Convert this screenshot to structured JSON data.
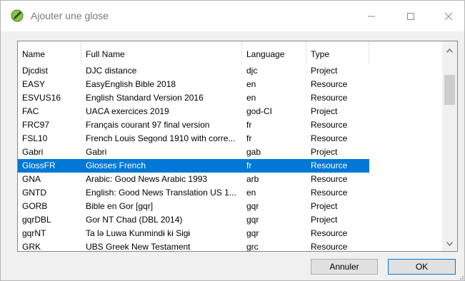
{
  "window": {
    "title": "Ajouter une glose"
  },
  "list": {
    "columns": [
      "Name",
      "Full Name",
      "Language",
      "Type",
      ""
    ],
    "rows": [
      {
        "name": "Djcdist",
        "full_name": "DJC distance",
        "language": "djc",
        "type": "Project",
        "selected": false
      },
      {
        "name": "EASY",
        "full_name": "EasyEnglish Bible 2018",
        "language": "en",
        "type": "Resource",
        "selected": false
      },
      {
        "name": "ESVUS16",
        "full_name": "English Standard Version 2016",
        "language": "en",
        "type": "Resource",
        "selected": false
      },
      {
        "name": "FAC",
        "full_name": "UACA exercices 2019",
        "language": "god-CI",
        "type": "Project",
        "selected": false
      },
      {
        "name": "FRC97",
        "full_name": "Français courant 97 final version",
        "language": "fr",
        "type": "Resource",
        "selected": false
      },
      {
        "name": "FSL10",
        "full_name": "French Louis Segond 1910 with corre...",
        "language": "fr",
        "type": "Resource",
        "selected": false
      },
      {
        "name": "Gabri",
        "full_name": "Gabri",
        "language": "gab",
        "type": "Project",
        "selected": false
      },
      {
        "name": "GlossFR",
        "full_name": "Glosses French",
        "language": "fr",
        "type": "Resource",
        "selected": true
      },
      {
        "name": "GNA",
        "full_name": "Arabic: Good News Arabic 1993",
        "language": "arb",
        "type": "Resource",
        "selected": false
      },
      {
        "name": "GNTD",
        "full_name": "English: Good News Translation US 1...",
        "language": "en",
        "type": "Resource",
        "selected": false
      },
      {
        "name": "GORB",
        "full_name": "Bible en Gor [gqr]",
        "language": "gqr",
        "type": "Project",
        "selected": false
      },
      {
        "name": "gqrDBL",
        "full_name": "Gor NT Chad (DBL 2014)",
        "language": "gqr",
        "type": "Project",
        "selected": false
      },
      {
        "name": "gqrNT",
        "full_name": "Ta lə Luwa Kunmindɨ kɨ Sigɨ",
        "language": "gqr",
        "type": "Resource",
        "selected": false
      },
      {
        "name": "GRK",
        "full_name": "UBS Greek New Testament",
        "language": "grc",
        "type": "Resource",
        "selected": false
      }
    ]
  },
  "buttons": {
    "cancel_label": "Annuler",
    "ok_label": "OK"
  },
  "colors": {
    "selection": "#0078d7",
    "icon_green": "#8bc34a"
  },
  "icons": {
    "app": "pencil-circle-icon",
    "minimize": "minimize-icon",
    "maximize": "maximize-icon",
    "close": "close-icon",
    "scroll_up": "chevron-up-icon",
    "scroll_down": "chevron-down-icon"
  }
}
